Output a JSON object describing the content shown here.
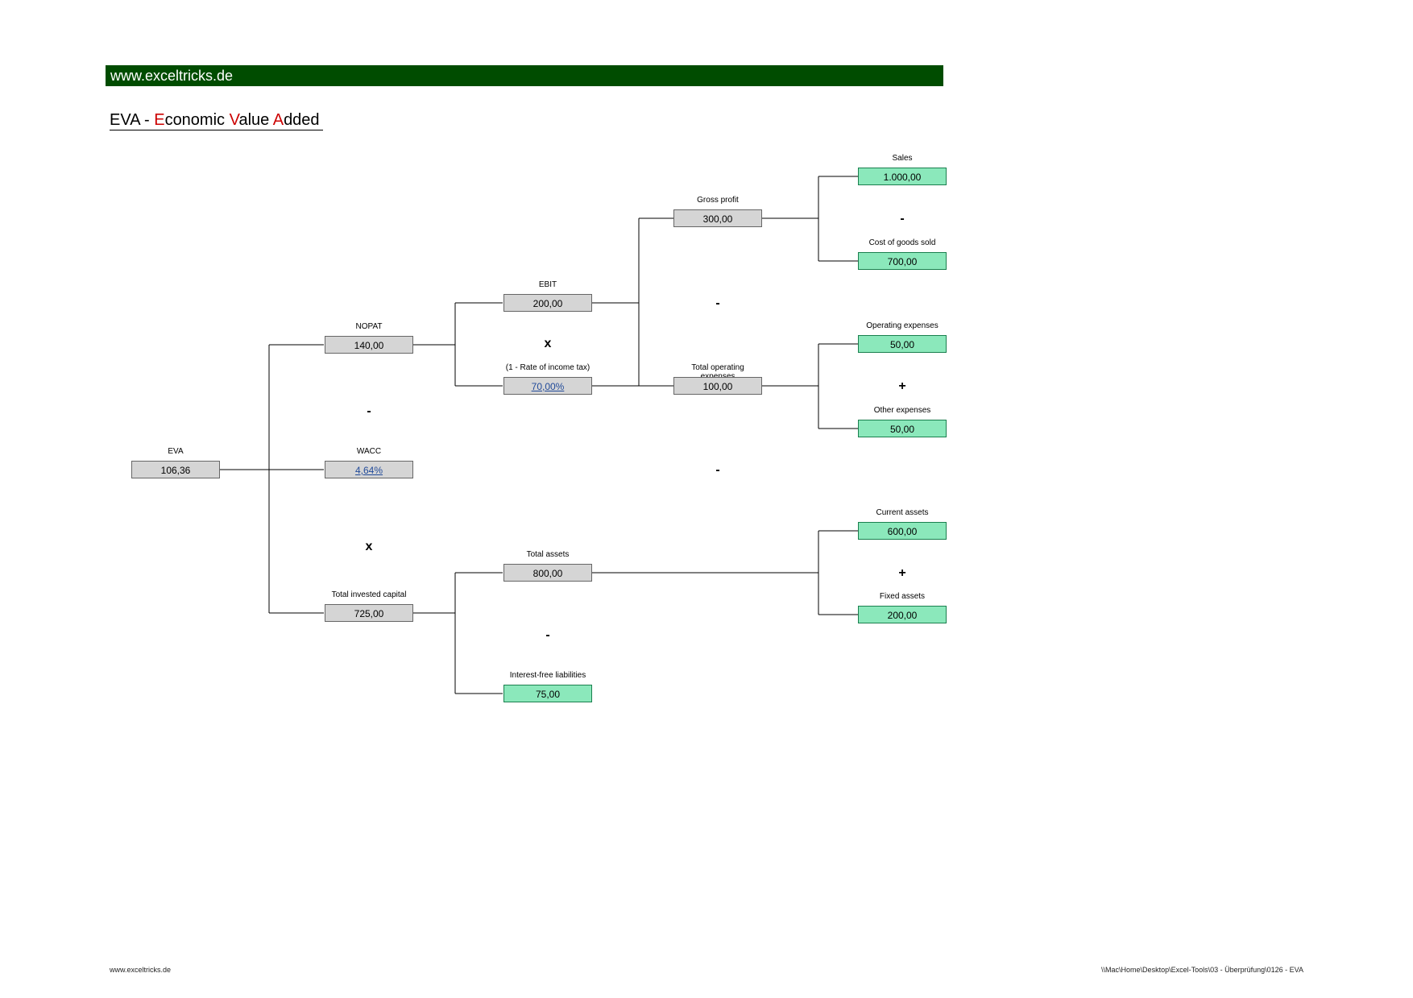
{
  "header": {
    "url": "www.exceltricks.de"
  },
  "title": {
    "prefix": "EVA - ",
    "e": "E",
    "conomic": "conomic ",
    "v": "V",
    "alue": "alue ",
    "a": "A",
    "dded": "dded"
  },
  "nodes": {
    "eva": {
      "label": "EVA",
      "value": "106,36"
    },
    "nopat": {
      "label": "NOPAT",
      "value": "140,00"
    },
    "wacc": {
      "label": "WACC",
      "value": "4,64%"
    },
    "total_invested": {
      "label": "Total invested capital",
      "value": "725,00"
    },
    "ebit": {
      "label": "EBIT",
      "value": "200,00"
    },
    "tax": {
      "label": "(1 - Rate of income tax)",
      "value": "70,00%"
    },
    "total_assets": {
      "label": "Total assets",
      "value": "800,00"
    },
    "ifl": {
      "label": "Interest-free liabilities",
      "value": "75,00"
    },
    "gross_profit": {
      "label": "Gross profit",
      "value": "300,00"
    },
    "total_opex": {
      "label": "Total operating expenses",
      "value": "100,00"
    },
    "sales": {
      "label": "Sales",
      "value": "1.000,00"
    },
    "cogs": {
      "label": "Cost of goods sold",
      "value": "700,00"
    },
    "opex": {
      "label": "Operating expenses",
      "value": "50,00"
    },
    "other_exp": {
      "label": "Other expenses",
      "value": "50,00"
    },
    "current_assets": {
      "label": "Current assets",
      "value": "600,00"
    },
    "fixed_assets": {
      "label": "Fixed assets",
      "value": "200,00"
    }
  },
  "ops": {
    "nopat_minus": "-",
    "nopat_times": "x",
    "ebit_times": "x",
    "gp_minus": "-",
    "sales_minus": "-",
    "opex_plus": "+",
    "ta_minus": "-",
    "assets_plus": "+",
    "gp_toe_minus": "-"
  },
  "footer": {
    "left": "www.exceltricks.de",
    "right": "\\\\Mac\\Home\\Desktop\\Excel-Tools\\03 - Überprüfung\\0126 - EVA"
  }
}
